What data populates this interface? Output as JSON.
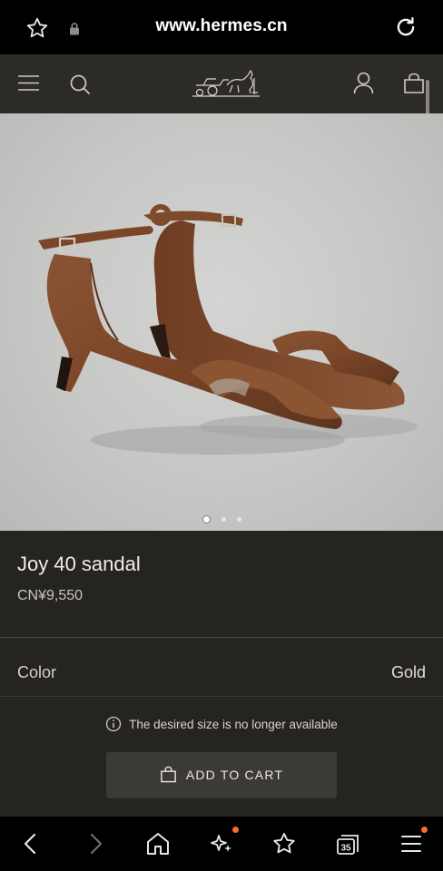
{
  "browser": {
    "url": "www.hermes.cn",
    "icons": [
      "star-icon",
      "lock-icon",
      "reload-icon"
    ]
  },
  "header": {
    "icons": [
      "menu-icon",
      "search-icon",
      "hermes-logo",
      "account-icon",
      "bag-icon"
    ]
  },
  "gallery": {
    "image": "brown leather sandal pair",
    "slide_count": 3,
    "active_slide": 1
  },
  "product": {
    "name": "Joy 40 sandal",
    "price": "CN¥9,550"
  },
  "color": {
    "label": "Color",
    "value": "Gold"
  },
  "availability": {
    "notice": "The desired size is no longer available"
  },
  "actions": {
    "add_to_cart": "ADD TO CART"
  },
  "bottom_nav": {
    "items": [
      "back-icon",
      "forward-icon",
      "home-icon",
      "ai-sparkle-icon",
      "favorites-icon",
      "tabs-icon",
      "menu-icon"
    ],
    "tabs_count": "35",
    "accent": "#ff6a2c"
  },
  "colors": {
    "background": "#262421",
    "header": "#2d2b28",
    "button": "#3c3a37"
  }
}
